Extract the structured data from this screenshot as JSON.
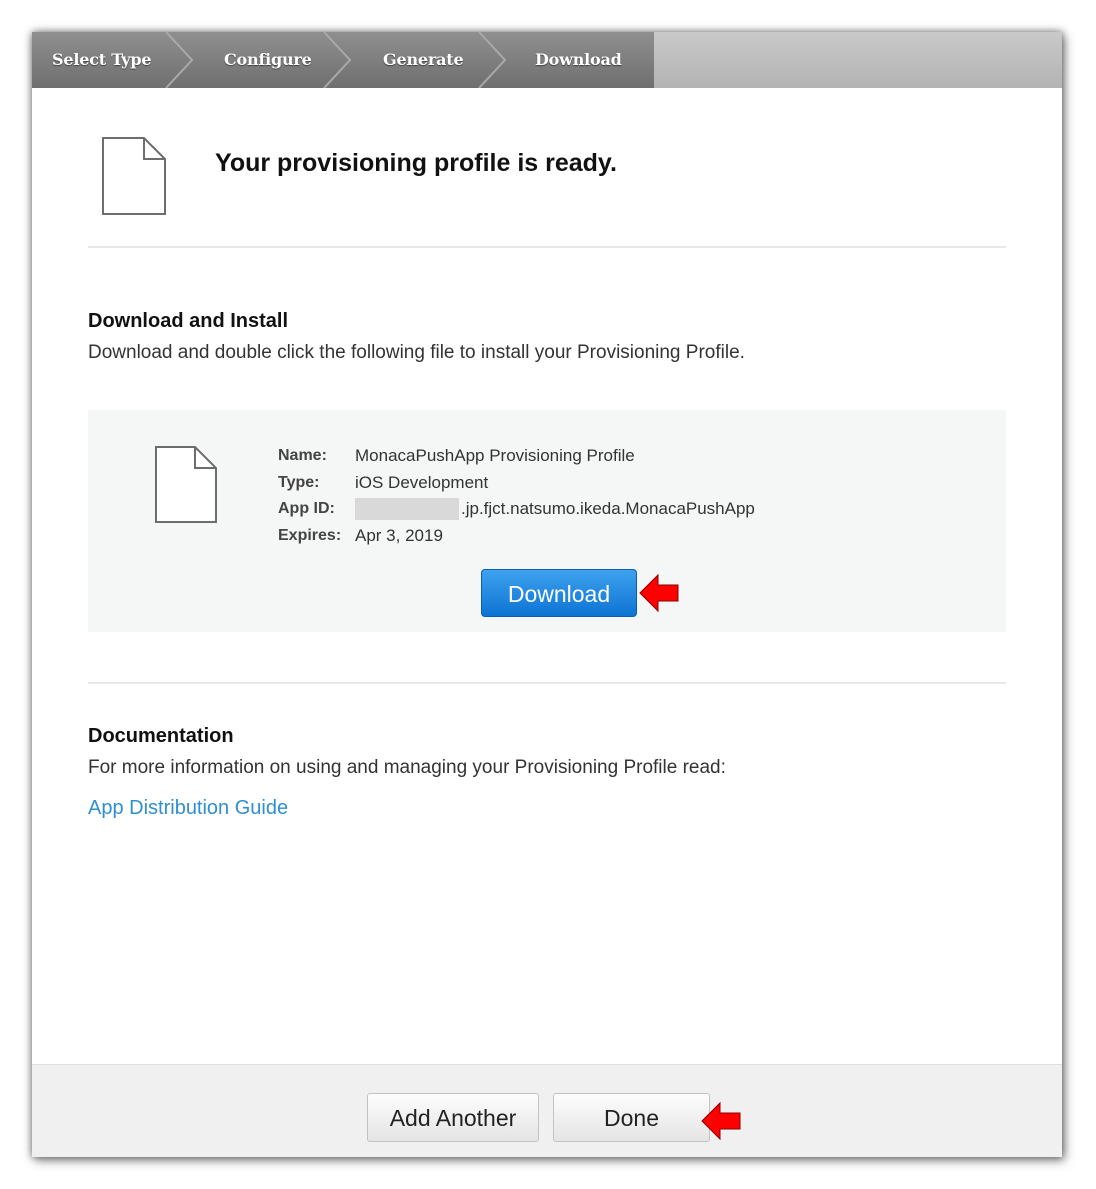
{
  "steps": [
    {
      "label": "Select Type"
    },
    {
      "label": "Configure"
    },
    {
      "label": "Generate"
    },
    {
      "label": "Download"
    }
  ],
  "header": {
    "title": "Your provisioning profile is ready.",
    "icon": "document-icon"
  },
  "download_section": {
    "heading": "Download and Install",
    "description": "Download and double click the following file to install your Provisioning Profile."
  },
  "profile": {
    "icon": "document-icon",
    "name_label": "Name:",
    "name_value": "MonacaPushApp Provisioning Profile",
    "type_label": "Type:",
    "type_value": "iOS Development",
    "appid_label": "App ID:",
    "appid_value": ".jp.fjct.natsumo.ikeda.MonacaPushApp",
    "expires_label": "Expires:",
    "expires_value": "Apr 3, 2019",
    "download_label": "Download"
  },
  "documentation": {
    "heading": "Documentation",
    "description": "For more information on using and managing your Provisioning Profile read:",
    "link_label": "App Distribution Guide"
  },
  "footer": {
    "add_another_label": "Add Another",
    "done_label": "Done"
  },
  "colors": {
    "accent_blue": "#0d74d3",
    "link_blue": "#2e8fd4",
    "annotation_red": "#ff0000",
    "steps_dark": "#7a7a7a",
    "steps_light": "#bdbdbd"
  },
  "annotations": [
    "red-arrow-icon",
    "red-arrow-icon"
  ]
}
